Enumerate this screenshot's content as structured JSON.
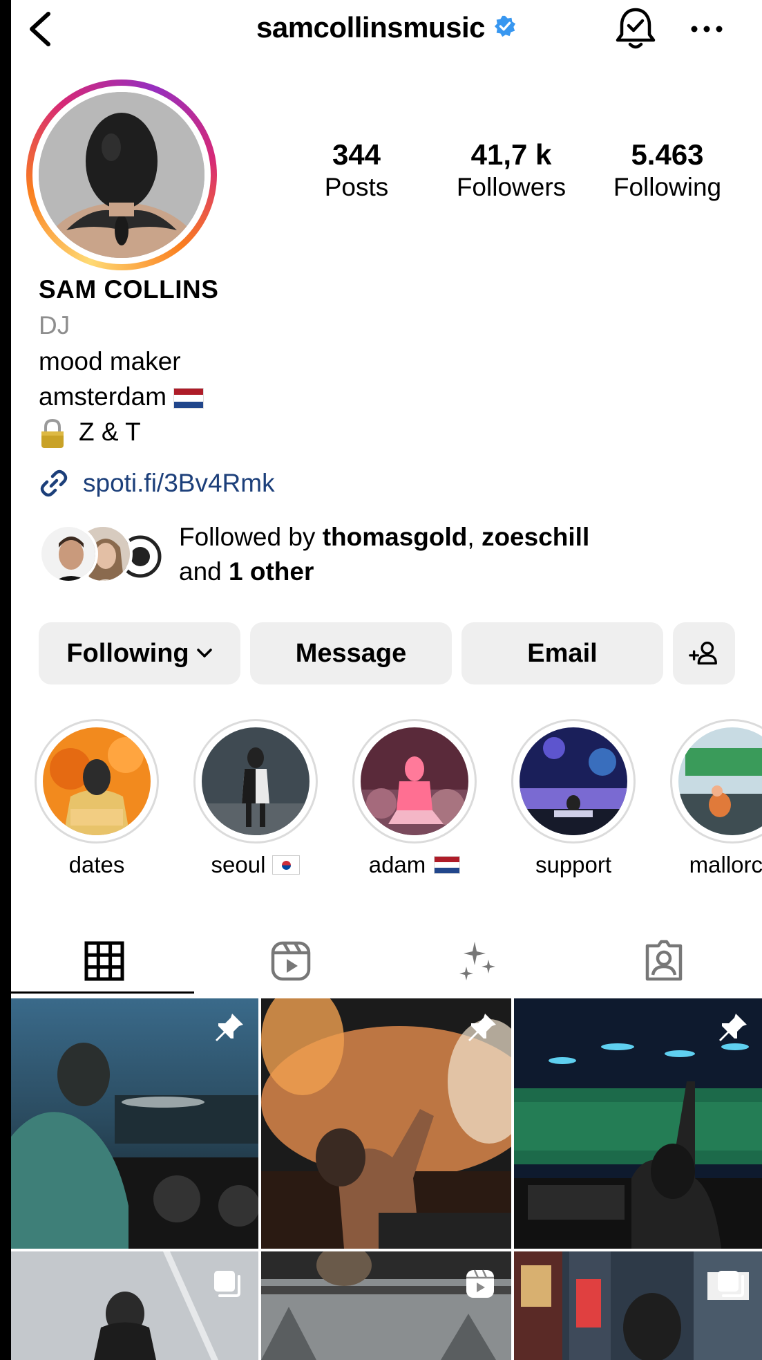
{
  "header": {
    "username": "samcollinsmusic",
    "verified": true
  },
  "stats": [
    {
      "value": "344",
      "label": "Posts"
    },
    {
      "value": "41,7 k",
      "label": "Followers"
    },
    {
      "value": "5.463",
      "label": "Following"
    }
  ],
  "profile": {
    "name": "SAM COLLINS",
    "category": "DJ",
    "bio": {
      "line1": "mood maker",
      "line2": "amsterdam",
      "line3": "Z & T"
    },
    "link": "spoti.fi/3Bv4Rmk"
  },
  "followed_by": {
    "prefix": "Followed by ",
    "user1": "thomasgold",
    "separator": ", ",
    "user2": "zoeschill",
    "and": "and ",
    "other": "1 other"
  },
  "buttons": {
    "following": "Following",
    "message": "Message",
    "email": "Email"
  },
  "highlights": [
    {
      "label": "dates"
    },
    {
      "label": "seoul"
    },
    {
      "label": "adam"
    },
    {
      "label": "support"
    },
    {
      "label": "mallorca"
    }
  ],
  "colors": {
    "link": "#1c3f7a",
    "verified": "#3897f0",
    "button_bg": "#efefef",
    "secondary_text": "#8e8e8e"
  },
  "icons": {
    "back": "chevron-left-icon",
    "verified": "verified-badge-icon",
    "bell": "bell-check-icon",
    "more": "more-horizontal-icon",
    "link": "link-icon",
    "lock": "lock-icon",
    "grid_tab": "grid-icon",
    "reels_tab": "reels-icon",
    "ai_tab": "sparkles-icon",
    "tagged_tab": "tagged-user-icon",
    "pin": "pin-icon",
    "carousel": "carousel-icon"
  }
}
